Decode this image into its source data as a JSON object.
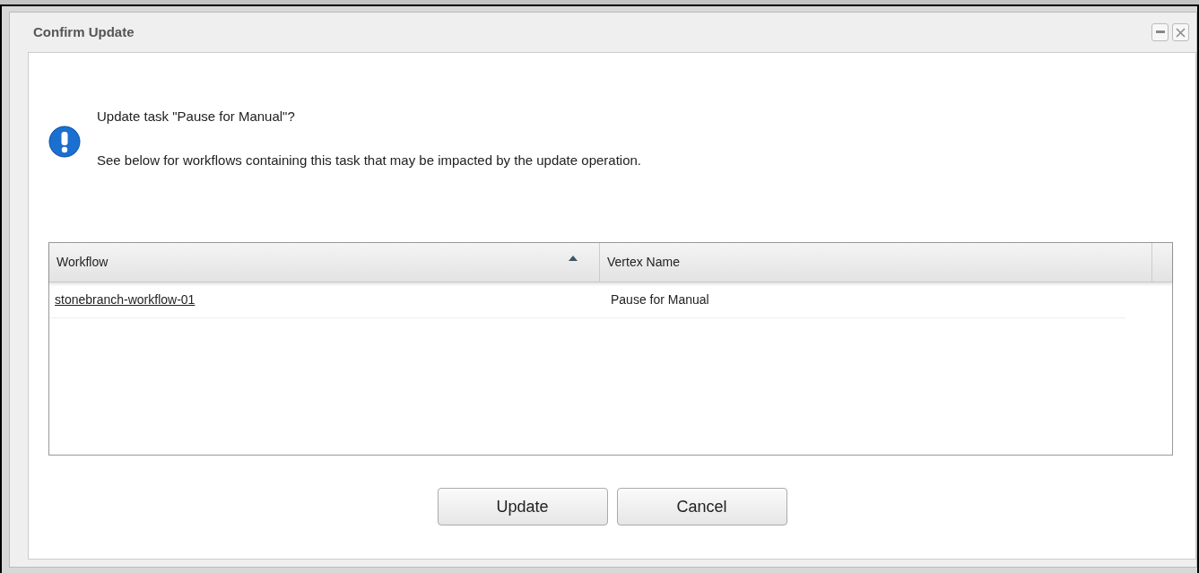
{
  "window": {
    "title": "Confirm Update"
  },
  "message": {
    "question": "Update task \"Pause for Manual\"?",
    "detail": "See below for workflows containing this task that may be impacted by the update operation."
  },
  "table": {
    "columns": [
      {
        "label": "Workflow",
        "sorted": true
      },
      {
        "label": "Vertex Name",
        "sorted": false
      }
    ],
    "rows": [
      {
        "workflow": "stonebranch-workflow-01",
        "vertex_name": "Pause for Manual"
      }
    ]
  },
  "buttons": [
    "Update",
    "Cancel"
  ]
}
